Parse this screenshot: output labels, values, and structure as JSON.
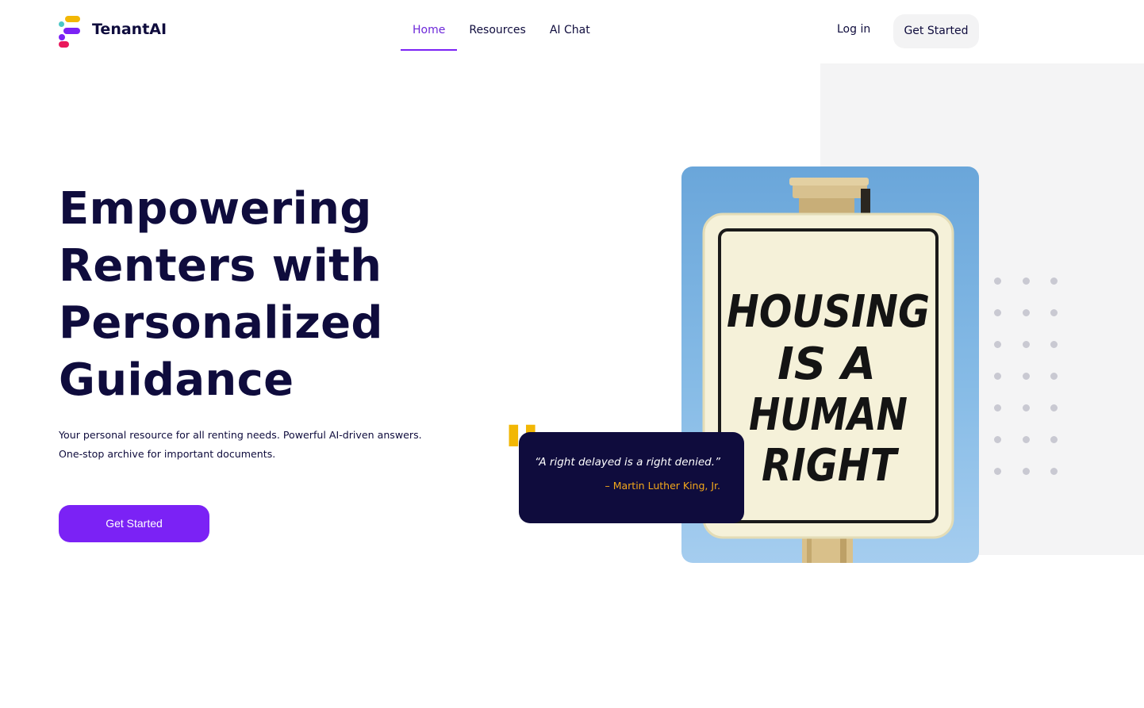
{
  "brand": {
    "name": "TenantAI"
  },
  "nav": {
    "items": [
      {
        "label": "Home",
        "active": true
      },
      {
        "label": "Resources",
        "active": false
      },
      {
        "label": "AI Chat",
        "active": false
      }
    ],
    "login_label": "Log in",
    "cta_label": "Get Started"
  },
  "hero": {
    "title": "Empowering Renters with Personalized Guidance",
    "subtitle": "Your personal resource for all renting needs. Powerful AI-driven answers. One-stop archive for important documents.",
    "cta_label": "Get Started"
  },
  "photo": {
    "sign_text": [
      "HOUSING",
      "IS A",
      "HUMAN",
      "RIGHT"
    ]
  },
  "quote": {
    "text": "“A right delayed is a right denied.”",
    "author": "– Martin Luther King, Jr."
  },
  "colors": {
    "brand_purple": "#7b22f5",
    "navy": "#0f0c3d",
    "accent_yellow": "#f2b705",
    "quote_author": "#f2a71b"
  }
}
